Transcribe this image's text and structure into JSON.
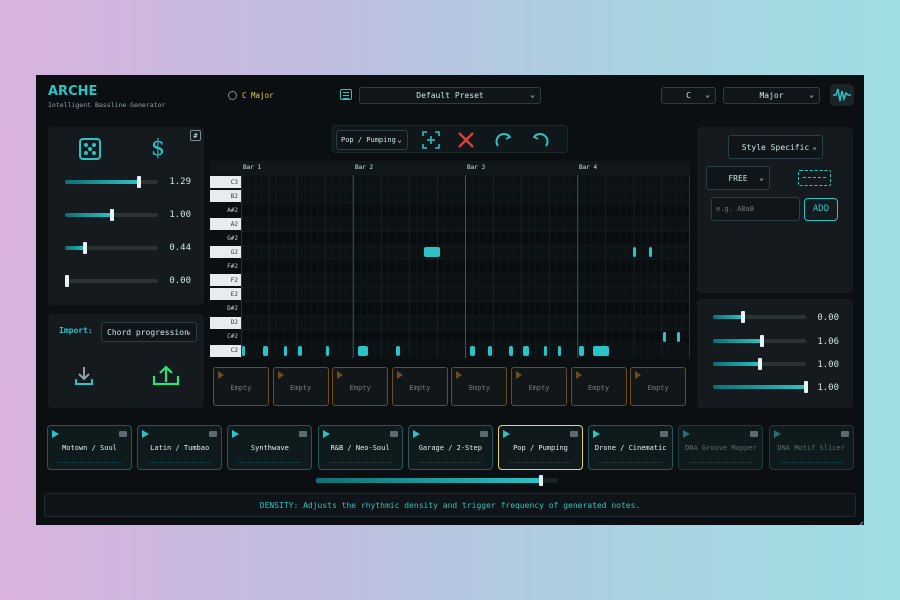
{
  "app": {
    "title": "ARCHE",
    "subtitle": "Intelligent Bassline Generator"
  },
  "header": {
    "key_badge": "C Major",
    "preset": "Default Preset",
    "root_select": "C",
    "scale_select": "Major"
  },
  "left": {
    "hash_button": "#",
    "sliders": [
      {
        "value": "1.29",
        "level": 0.8
      },
      {
        "value": "1.00",
        "level": 0.5
      },
      {
        "value": "0.44",
        "level": 0.22
      },
      {
        "value": "0.00",
        "level": 0.0
      }
    ],
    "import_label": "Import:",
    "import_select": "Chord progression"
  },
  "toolbar": {
    "style_select": "Pop / Pumping"
  },
  "roll": {
    "bars": [
      "Bar 1",
      "Bar 2",
      "Bar 3",
      "Bar 4"
    ],
    "keys": [
      {
        "label": "C3",
        "type": "w"
      },
      {
        "label": "B2",
        "type": "w"
      },
      {
        "label": "A#2",
        "type": "b"
      },
      {
        "label": "A2",
        "type": "w"
      },
      {
        "label": "G#2",
        "type": "b"
      },
      {
        "label": "G2",
        "type": "w"
      },
      {
        "label": "F#2",
        "type": "b"
      },
      {
        "label": "F2",
        "type": "w"
      },
      {
        "label": "E2",
        "type": "w"
      },
      {
        "label": "D#2",
        "type": "b"
      },
      {
        "label": "D2",
        "type": "w"
      },
      {
        "label": "C#2",
        "type": "b"
      },
      {
        "label": "C2",
        "type": "w"
      }
    ]
  },
  "slots": [
    "Empty",
    "Empty",
    "Empty",
    "Empty",
    "Empty",
    "Empty",
    "Empty",
    "Empty"
  ],
  "right": {
    "mode_select": "Style Specific",
    "free_select": "FREE",
    "motif_placeholder": "e.g. ABaB",
    "add_button": "ADD",
    "sliders": [
      {
        "value": "0.00",
        "level": 0.32
      },
      {
        "value": "1.06",
        "level": 0.53
      },
      {
        "value": "1.00",
        "level": 0.5
      },
      {
        "value": "1.00",
        "level": 1.0
      }
    ]
  },
  "styles": [
    {
      "name": "Motown / Soul",
      "state": "normal"
    },
    {
      "name": "Latin / Tumbao",
      "state": "normal"
    },
    {
      "name": "Synthwave",
      "state": "normal"
    },
    {
      "name": "R&B / Neo-Soul",
      "state": "normal"
    },
    {
      "name": "Garage / 2-Step",
      "state": "normal"
    },
    {
      "name": "Pop / Pumping",
      "state": "active"
    },
    {
      "name": "Drone / Cinematic",
      "state": "normal"
    },
    {
      "name": "DNA Groove Mapper",
      "state": "dim"
    },
    {
      "name": "DNA Motif Slicer",
      "state": "dim"
    }
  ],
  "scroll_position": 0.93,
  "status": "DENSITY: Adjusts the rhythmic density and trigger frequency of generated notes.",
  "colors": {
    "accent": "#2ac3c6",
    "active": "#e6d36b",
    "delete": "#e0403a",
    "export": "#2ee07a",
    "background": "#0b0f12"
  }
}
